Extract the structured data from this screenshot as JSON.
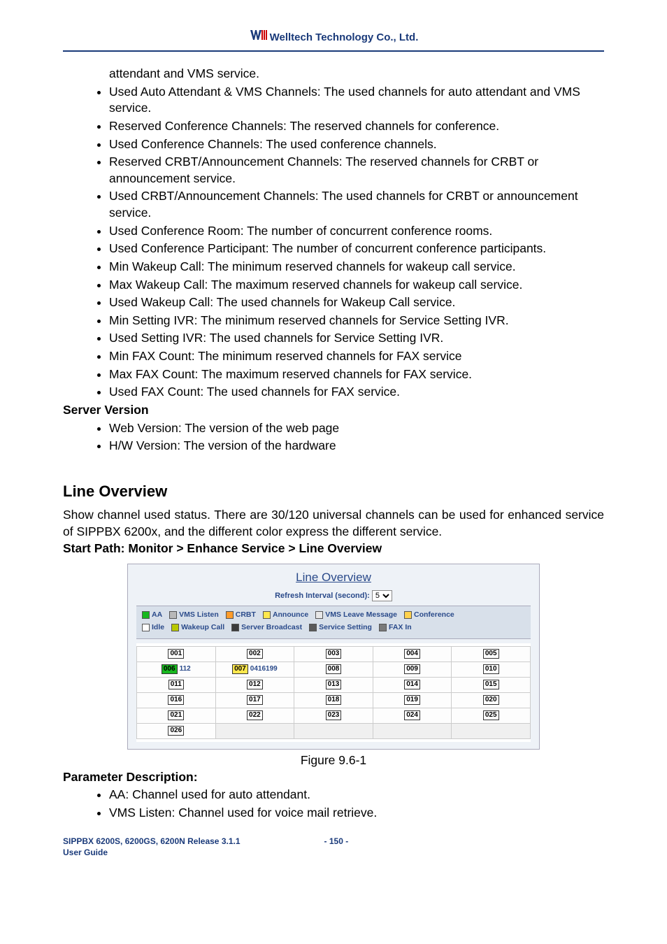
{
  "header": {
    "company": "Welltech Technology Co., Ltd."
  },
  "intro_line": "attendant and VMS service.",
  "bullets_main": [
    "Used Auto Attendant & VMS Channels: The used channels for auto attendant and VMS service.",
    "Reserved Conference Channels: The reserved channels for conference.",
    "Used Conference Channels: The used conference channels.",
    "Reserved CRBT/Announcement Channels: The reserved channels for CRBT or announcement service.",
    "Used CRBT/Announcement Channels: The used channels for CRBT or announcement service.",
    "Used Conference Room: The number of concurrent conference rooms.",
    "Used Conference Participant: The number of concurrent conference participants.",
    "Min Wakeup Call: The minimum reserved channels for wakeup call service.",
    "Max Wakeup Call: The maximum reserved channels for wakeup call service.",
    "Used Wakeup Call: The used channels for Wakeup Call service.",
    "Min Setting IVR: The minimum reserved channels for Service Setting IVR.",
    "Used Setting IVR: The used channels for Service Setting IVR.",
    "Min FAX Count: The minimum reserved channels for FAX service",
    "Max FAX Count: The maximum reserved channels for FAX service.",
    "Used FAX Count: The used channels for FAX service."
  ],
  "server_version_heading": "Server Version",
  "bullets_server": [
    "Web Version: The version of the web page",
    "H/W Version: The version of the hardware"
  ],
  "line_overview": {
    "heading": "Line Overview",
    "paragraph": "Show channel used status. There are 30/120 universal channels can be used for enhanced service of SIPPBX 6200x, and the different color express the different service.",
    "start_path": "Start Path: Monitor > Enhance Service > Line Overview",
    "widget": {
      "title": "Line Overview",
      "refresh_label": "Refresh Interval (second):",
      "refresh_value": "5",
      "legend_row1": [
        {
          "label": "AA",
          "cls": "sw-aa"
        },
        {
          "label": "VMS Listen",
          "cls": "sw-vmsl"
        },
        {
          "label": "CRBT",
          "cls": "sw-crbt"
        },
        {
          "label": "Announce",
          "cls": "sw-ann"
        },
        {
          "label": "VMS Leave Message",
          "cls": "sw-vmslm"
        },
        {
          "label": "Conference",
          "cls": "sw-conf"
        }
      ],
      "legend_row2": [
        {
          "label": "Idle",
          "cls": "sw-idle"
        },
        {
          "label": "Wakeup Call",
          "cls": "sw-wakeup"
        },
        {
          "label": "Server Broadcast",
          "cls": "sw-sbcast"
        },
        {
          "label": "Service Setting",
          "cls": "sw-svcset"
        },
        {
          "label": "FAX In",
          "cls": "sw-faxin"
        }
      ],
      "cells": [
        [
          {
            "id": "001",
            "state": "idle"
          },
          {
            "id": "002",
            "state": "idle"
          },
          {
            "id": "003",
            "state": "idle"
          },
          {
            "id": "004",
            "state": "idle"
          },
          {
            "id": "005",
            "state": "idle"
          }
        ],
        [
          {
            "id": "006",
            "state": "aa",
            "sub": "112"
          },
          {
            "id": "007",
            "state": "ann",
            "sub": "0416199"
          },
          {
            "id": "008",
            "state": "idle"
          },
          {
            "id": "009",
            "state": "idle"
          },
          {
            "id": "010",
            "state": "idle"
          }
        ],
        [
          {
            "id": "011",
            "state": "idle"
          },
          {
            "id": "012",
            "state": "idle"
          },
          {
            "id": "013",
            "state": "idle"
          },
          {
            "id": "014",
            "state": "idle"
          },
          {
            "id": "015",
            "state": "idle"
          }
        ],
        [
          {
            "id": "016",
            "state": "idle"
          },
          {
            "id": "017",
            "state": "idle"
          },
          {
            "id": "018",
            "state": "idle"
          },
          {
            "id": "019",
            "state": "idle"
          },
          {
            "id": "020",
            "state": "idle"
          }
        ],
        [
          {
            "id": "021",
            "state": "idle"
          },
          {
            "id": "022",
            "state": "idle"
          },
          {
            "id": "023",
            "state": "idle"
          },
          {
            "id": "024",
            "state": "idle"
          },
          {
            "id": "025",
            "state": "idle"
          }
        ],
        [
          {
            "id": "026",
            "state": "idle"
          },
          {
            "empty": true
          },
          {
            "empty": true
          },
          {
            "empty": true
          },
          {
            "empty": true
          }
        ]
      ]
    },
    "figure_caption": "Figure 9.6-1"
  },
  "param_desc": {
    "heading": "Parameter Description:",
    "bullets": [
      "AA: Channel used for auto attendant.",
      "VMS Listen: Channel used for voice mail retrieve."
    ]
  },
  "footer": {
    "left_line1": "SIPPBX 6200S, 6200GS, 6200N Release 3.1.1",
    "left_line2": "User Guide",
    "page": "- 150 -"
  }
}
